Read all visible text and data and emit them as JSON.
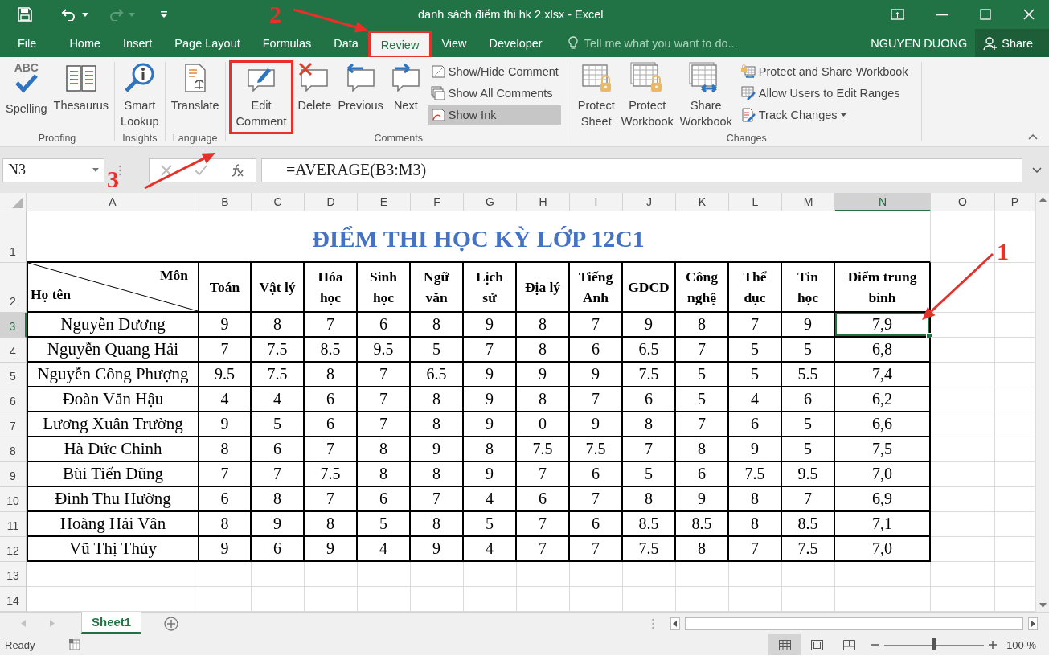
{
  "title_bar": {
    "title": "danh sách điểm thi hk 2.xlsx - Excel"
  },
  "menu": {
    "tabs": [
      {
        "label": "File",
        "selected": false,
        "highlighted": false
      },
      {
        "label": "Home",
        "selected": false,
        "highlighted": false
      },
      {
        "label": "Insert",
        "selected": false,
        "highlighted": false
      },
      {
        "label": "Page Layout",
        "selected": false,
        "highlighted": false
      },
      {
        "label": "Formulas",
        "selected": false,
        "highlighted": false
      },
      {
        "label": "Data",
        "selected": false,
        "highlighted": false
      },
      {
        "label": "Review",
        "selected": true,
        "highlighted": true
      },
      {
        "label": "View",
        "selected": false,
        "highlighted": false
      },
      {
        "label": "Developer",
        "selected": false,
        "highlighted": false
      }
    ],
    "tell_me": {
      "placeholder": "Tell me what you want to do..."
    },
    "user": "NGUYEN DUONG",
    "share": "Share"
  },
  "ribbon": {
    "groups": [
      {
        "label": "Proofing",
        "items": [
          {
            "kind": "large",
            "label": "Spelling",
            "icon_text": "ABC",
            "highlighted": false
          },
          {
            "kind": "large",
            "label": "Thesaurus",
            "highlighted": false
          }
        ]
      },
      {
        "label": "Insights",
        "items": [
          {
            "kind": "large",
            "label": "Smart\nLookup",
            "highlighted": false
          }
        ]
      },
      {
        "label": "Language",
        "items": [
          {
            "kind": "large",
            "label": "Translate",
            "highlighted": false
          }
        ]
      },
      {
        "label": "Comments",
        "items": [
          {
            "kind": "large",
            "label": "Edit\nComment",
            "highlighted": true
          },
          {
            "kind": "large",
            "label": "Delete",
            "highlighted": false
          },
          {
            "kind": "large",
            "label": "Previous",
            "highlighted": false
          },
          {
            "kind": "large",
            "label": "Next",
            "highlighted": false
          },
          {
            "kind": "small",
            "label": "Show/Hide Comment",
            "pressed": false,
            "dropdown": false
          },
          {
            "kind": "small",
            "label": "Show All Comments",
            "pressed": false,
            "dropdown": false
          },
          {
            "kind": "small",
            "label": "Show Ink",
            "pressed": true,
            "dropdown": false
          }
        ]
      },
      {
        "label": "Changes",
        "items": [
          {
            "kind": "large",
            "label": "Protect\nSheet",
            "highlighted": false
          },
          {
            "kind": "large",
            "label": "Protect\nWorkbook",
            "highlighted": false
          },
          {
            "kind": "large",
            "label": "Share\nWorkbook",
            "highlighted": false
          },
          {
            "kind": "small",
            "label": "Protect and Share Workbook",
            "pressed": false,
            "dropdown": false
          },
          {
            "kind": "small",
            "label": "Allow Users to Edit Ranges",
            "pressed": false,
            "dropdown": false
          },
          {
            "kind": "small",
            "label": "Track Changes",
            "pressed": false,
            "dropdown": true
          }
        ]
      }
    ]
  },
  "formula_bar": {
    "name_box": "N3",
    "formula": "=AVERAGE(B3:M3)"
  },
  "sheet": {
    "columns": [
      {
        "label": "A",
        "selected": false
      },
      {
        "label": "B",
        "selected": false
      },
      {
        "label": "C",
        "selected": false
      },
      {
        "label": "D",
        "selected": false
      },
      {
        "label": "E",
        "selected": false
      },
      {
        "label": "F",
        "selected": false
      },
      {
        "label": "G",
        "selected": false
      },
      {
        "label": "H",
        "selected": false
      },
      {
        "label": "I",
        "selected": false
      },
      {
        "label": "J",
        "selected": false
      },
      {
        "label": "K",
        "selected": false
      },
      {
        "label": "L",
        "selected": false
      },
      {
        "label": "M",
        "selected": false
      },
      {
        "label": "N",
        "selected": true
      },
      {
        "label": "O",
        "selected": false
      },
      {
        "label": "P",
        "selected": false
      }
    ],
    "row_headers": [
      {
        "label": "1",
        "selected": false
      },
      {
        "label": "2",
        "selected": false
      },
      {
        "label": "3",
        "selected": true
      },
      {
        "label": "4",
        "selected": false
      },
      {
        "label": "5",
        "selected": false
      },
      {
        "label": "6",
        "selected": false
      },
      {
        "label": "7",
        "selected": false
      },
      {
        "label": "8",
        "selected": false
      },
      {
        "label": "9",
        "selected": false
      },
      {
        "label": "10",
        "selected": false
      },
      {
        "label": "11",
        "selected": false
      },
      {
        "label": "12",
        "selected": false
      },
      {
        "label": "13",
        "selected": false
      },
      {
        "label": "14",
        "selected": false
      }
    ],
    "title": "ĐIỂM THI HỌC KỲ LỚP 12C1",
    "header": {
      "subject_label": "Môn",
      "name_label": "Họ tên",
      "subjects": [
        "Toán",
        "Vật lý",
        "Hóa\nhọc",
        "Sinh\nhọc",
        "Ngữ\nvăn",
        "Lịch\nsử",
        "Địa lý",
        "Tiếng\nAnh",
        "GDCD",
        "Công\nnghệ",
        "Thể\ndục",
        "Tin\nhọc",
        "Điểm trung\nbình"
      ]
    },
    "students": [
      {
        "name": "Nguyễn Dương",
        "scores": [
          "9",
          "8",
          "7",
          "6",
          "8",
          "9",
          "8",
          "7",
          "9",
          "8",
          "7",
          "9"
        ],
        "average": "7,9"
      },
      {
        "name": "Nguyễn Quang Hải",
        "scores": [
          "7",
          "7.5",
          "8.5",
          "9.5",
          "5",
          "7",
          "8",
          "6",
          "6.5",
          "7",
          "5",
          "5"
        ],
        "average": "6,8"
      },
      {
        "name": "Nguyễn Công Phượng",
        "scores": [
          "9.5",
          "7.5",
          "8",
          "7",
          "6.5",
          "9",
          "9",
          "9",
          "7.5",
          "5",
          "5",
          "5.5"
        ],
        "average": "7,4"
      },
      {
        "name": "Đoàn Văn Hậu",
        "scores": [
          "4",
          "4",
          "6",
          "7",
          "8",
          "9",
          "8",
          "7",
          "6",
          "5",
          "4",
          "6"
        ],
        "average": "6,2"
      },
      {
        "name": "Lương Xuân Trường",
        "scores": [
          "9",
          "5",
          "6",
          "7",
          "8",
          "9",
          "0",
          "9",
          "8",
          "7",
          "6",
          "5"
        ],
        "average": "6,6"
      },
      {
        "name": "Hà Đức Chinh",
        "scores": [
          "8",
          "6",
          "7",
          "8",
          "9",
          "8",
          "7.5",
          "7.5",
          "7",
          "8",
          "9",
          "5"
        ],
        "average": "7,5"
      },
      {
        "name": "Bùi Tiến Dũng",
        "scores": [
          "7",
          "7",
          "7.5",
          "8",
          "8",
          "9",
          "7",
          "6",
          "5",
          "6",
          "7.5",
          "9.5"
        ],
        "average": "7,0"
      },
      {
        "name": "Đinh Thu Hường",
        "scores": [
          "6",
          "8",
          "7",
          "6",
          "7",
          "4",
          "6",
          "7",
          "8",
          "9",
          "8",
          "7"
        ],
        "average": "6,9"
      },
      {
        "name": "Hoàng Hải Vân",
        "scores": [
          "8",
          "9",
          "8",
          "5",
          "8",
          "5",
          "7",
          "6",
          "8.5",
          "8.5",
          "8",
          "8.5"
        ],
        "average": "7,1"
      },
      {
        "name": "Vũ Thị Thủy",
        "scores": [
          "9",
          "6",
          "9",
          "4",
          "9",
          "4",
          "7",
          "7",
          "7.5",
          "8",
          "7",
          "7.5"
        ],
        "average": "7,0"
      }
    ]
  },
  "sheet_tabs": [
    {
      "label": "Sheet1",
      "selected": true
    }
  ],
  "status_bar": {
    "status": "Ready",
    "zoom": {
      "level": 0.5,
      "reading": "100 %"
    }
  },
  "annotations": [
    {
      "label": "1"
    },
    {
      "label": "2"
    },
    {
      "label": "3"
    }
  ]
}
